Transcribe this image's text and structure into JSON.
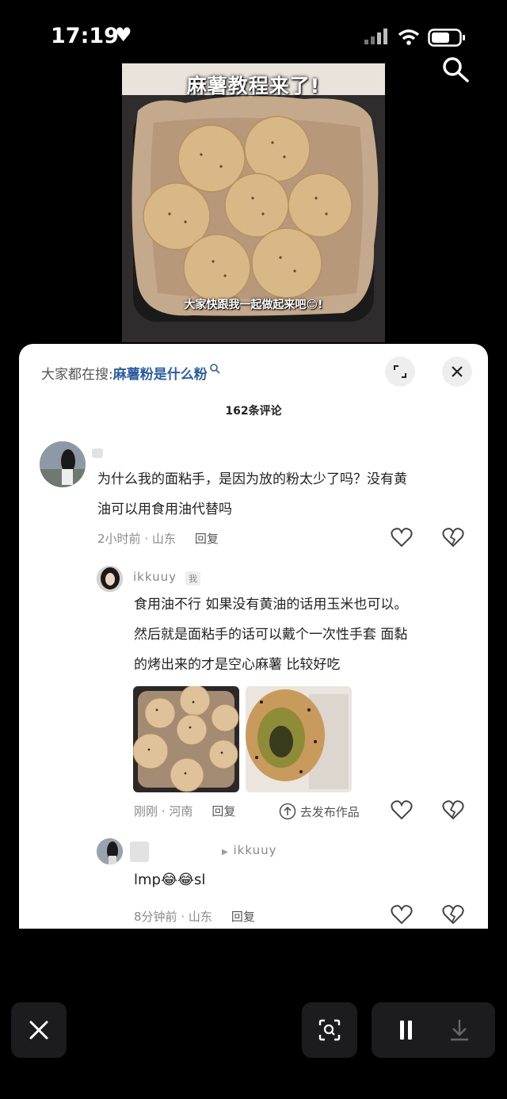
{
  "status_bar": {
    "time": "17:19",
    "heart": "♥"
  },
  "video": {
    "title": "麻薯教程来了!",
    "caption": "大家快跟我一起做起来吧😊!"
  },
  "comments_sheet": {
    "search_label": "大家都在搜:",
    "search_term": "麻薯粉是什么粉",
    "comment_count": "162条评论",
    "comments": [
      {
        "text_line1": "为什么我的面粘手，是因为放的粉太少了吗？没有黄",
        "text_line2": "油可以用食用油代替吗",
        "time": "2小时前",
        "location": "山东",
        "reply": "回复"
      },
      {
        "username": "ikkuuy",
        "tag": "我",
        "text_line1": "食用油不行  如果没有黄油的话用玉米也可以。",
        "text_line2": "然后就是面粘手的话可以戴个一次性手套  面黏",
        "text_line3": "的烤出来的才是空心麻薯  比较好吃",
        "time": "刚刚",
        "location": "河南",
        "reply": "回复",
        "publish": "去发布作品"
      },
      {
        "reply_to": "ikkuuy",
        "text": "lmp😂😂sl",
        "time": "8分钟前",
        "location": "山东",
        "reply": "回复"
      }
    ]
  }
}
